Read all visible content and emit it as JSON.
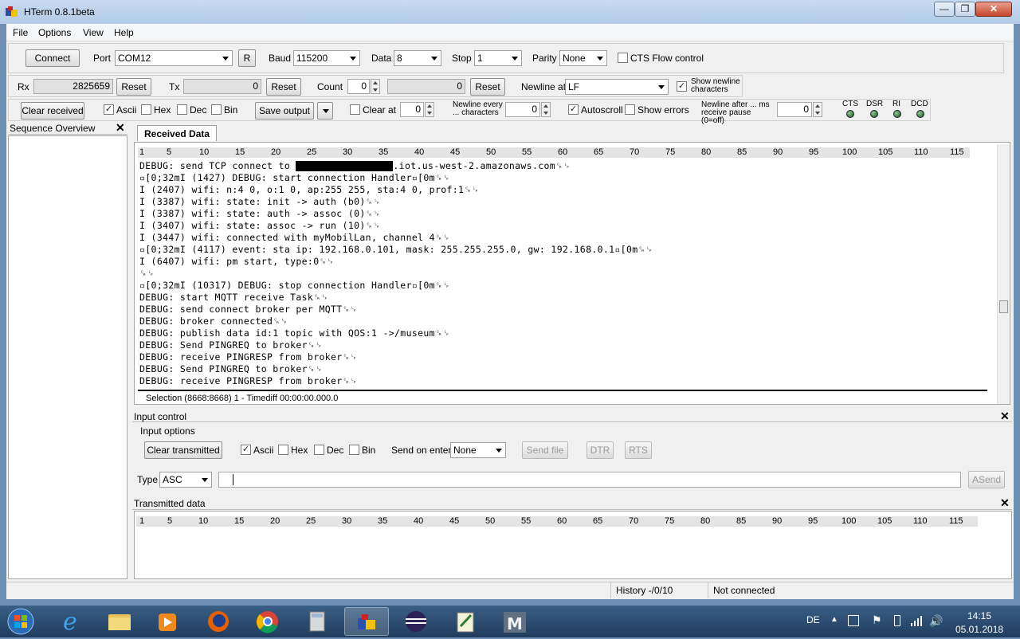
{
  "window": {
    "title": "HTerm 0.8.1beta",
    "min_glyph": "—",
    "max_glyph": "❐",
    "close_glyph": "✕"
  },
  "menu": [
    "File",
    "Options",
    "View",
    "Help"
  ],
  "connection": {
    "connect_label": "Connect",
    "port_label": "Port",
    "port_value": "COM12",
    "refresh_label": "R",
    "baud_label": "Baud",
    "baud_value": "115200",
    "data_label": "Data",
    "data_value": "8",
    "stop_label": "Stop",
    "stop_value": "1",
    "parity_label": "Parity",
    "parity_value": "None",
    "cts_flow_label": "CTS Flow control"
  },
  "counters": {
    "rx_label": "Rx",
    "rx_value": "2825659",
    "rx_reset": "Reset",
    "tx_label": "Tx",
    "tx_value": "0",
    "tx_reset": "Reset",
    "count_label": "Count",
    "count_value": "0",
    "count_total": "0",
    "count_reset": "Reset",
    "newline_at_label": "Newline at",
    "newline_at_value": "LF",
    "show_newline_label": "Show newline characters"
  },
  "display": {
    "clear_received": "Clear received",
    "ascii": "Ascii",
    "hex": "Hex",
    "dec": "Dec",
    "bin": "Bin",
    "save_output": "Save output",
    "clear_at_label": "Clear at",
    "clear_at_value": "0",
    "newline_every_label": "Newline every ... characters",
    "newline_every_value": "0",
    "autoscroll": "Autoscroll",
    "show_errors": "Show errors",
    "newline_after_label": "Newline after ... ms receive pause (0=off)",
    "newline_after_value": "0",
    "leds": [
      "CTS",
      "DSR",
      "RI",
      "DCD"
    ]
  },
  "sequence_overview": {
    "title": "Sequence Overview",
    "close": "✕"
  },
  "received": {
    "tab_label": "Received Data",
    "ruler": [
      "1",
      "5",
      "10",
      "15",
      "20",
      "25",
      "30",
      "35",
      "40",
      "45",
      "50",
      "55",
      "60",
      "65",
      "70",
      "75",
      "80",
      "85",
      "90",
      "95",
      "100",
      "105",
      "110",
      "115"
    ],
    "lines": [
      {
        "pre": "DEBUG: send TCP connect to ",
        "redacted": true,
        "post": ".iot.us-west-2.amazonaws.com␍␊"
      },
      {
        "pre": "▫[0;32mI (1427) DEBUG: start connection Handler▫[0m␍␊"
      },
      {
        "pre": "I (2407) wifi: n:4 0, o:1 0, ap:255 255, sta:4 0, prof:1␍␊"
      },
      {
        "pre": "I (3387) wifi: state: init -> auth (b0)␍␊"
      },
      {
        "pre": "I (3387) wifi: state: auth -> assoc (0)␍␊"
      },
      {
        "pre": "I (3407) wifi: state: assoc -> run (10)␍␊"
      },
      {
        "pre": "I (3447) wifi: connected with myMobilLan, channel 4␍␊"
      },
      {
        "pre": "▫[0;32mI (4117) event: sta ip: 192.168.0.101, mask: 255.255.255.0, gw: 192.168.0.1▫[0m␍␊"
      },
      {
        "pre": "I (6407) wifi: pm start, type:0␍␊"
      },
      {
        "pre": "␍␊"
      },
      {
        "pre": "▫[0;32mI (10317) DEBUG: stop connection Handler▫[0m␍␊"
      },
      {
        "pre": "DEBUG: start MQTT receive Task␍␊"
      },
      {
        "pre": "DEBUG: send connect broker per MQTT␍␊"
      },
      {
        "pre": "DEBUG: broker connected␍␊"
      },
      {
        "pre": "DEBUG: publish data id:1 topic with QOS:1 ->/museum␍␊"
      },
      {
        "pre": "DEBUG: Send PINGREQ to broker␍␊"
      },
      {
        "pre": "DEBUG: receive PINGRESP from broker␍␊"
      },
      {
        "pre": "DEBUG: Send PINGREQ to broker␍␊"
      },
      {
        "pre": "DEBUG: receive PINGRESP from broker␍␊"
      }
    ],
    "selection_info": "Selection (8668:8668) 1 - Timediff 00:00:00.000.0"
  },
  "input_control": {
    "title": "Input control",
    "close": "✕",
    "options_title": "Input options",
    "clear_transmitted": "Clear transmitted",
    "ascii": "Ascii",
    "hex": "Hex",
    "dec": "Dec",
    "bin": "Bin",
    "send_on_enter_label": "Send on enter",
    "send_on_enter_value": "None",
    "send_file": "Send file",
    "dtr": "DTR",
    "rts": "RTS",
    "type_label": "Type",
    "type_value": "ASC",
    "input_value": "",
    "asend": "ASend"
  },
  "transmitted": {
    "title": "Transmitted data",
    "close": "✕",
    "ruler": [
      "1",
      "5",
      "10",
      "15",
      "20",
      "25",
      "30",
      "35",
      "40",
      "45",
      "50",
      "55",
      "60",
      "65",
      "70",
      "75",
      "80",
      "85",
      "90",
      "95",
      "100",
      "105",
      "110",
      "115"
    ]
  },
  "status": {
    "history": "History -/0/10",
    "connection": "Not connected"
  },
  "taskbar": {
    "lang": "DE",
    "time": "14:15",
    "date": "05.01.2018"
  },
  "colors": {
    "titlebar": "#b2cbe8",
    "taskbar": "#1f3c5e",
    "redaction": "#000000"
  }
}
